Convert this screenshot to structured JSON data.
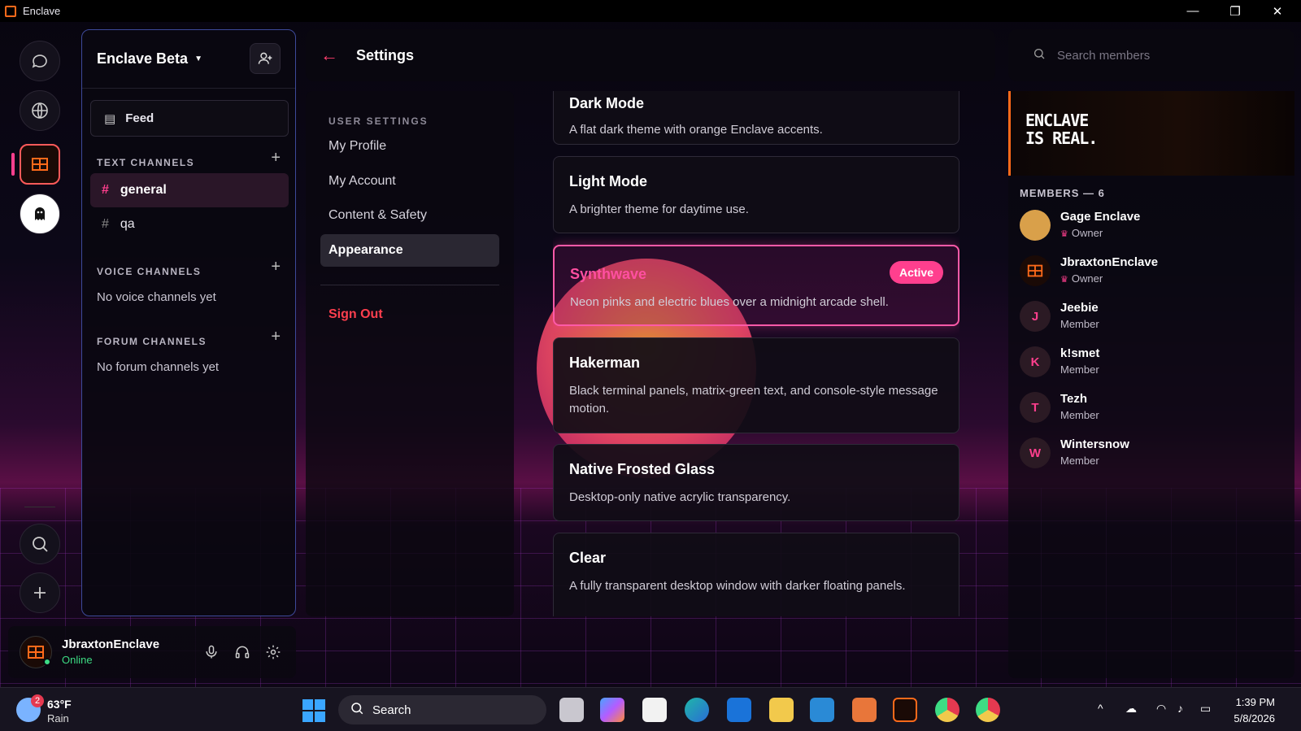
{
  "window": {
    "title": "Enclave",
    "minimize": "—",
    "restore": "❐",
    "close": "✕"
  },
  "rail": {
    "items": [
      {
        "name": "messages-icon"
      },
      {
        "name": "globe-icon"
      },
      {
        "name": "enclave-server-icon"
      },
      {
        "name": "ghost-server-icon"
      },
      {
        "name": "search-icon"
      },
      {
        "name": "add-server-icon"
      }
    ]
  },
  "server": {
    "name": "Enclave Beta",
    "feed_label": "Feed",
    "text_channels_title": "TEXT CHANNELS",
    "text_channels": [
      {
        "name": "general",
        "active": true
      },
      {
        "name": "qa",
        "active": false
      }
    ],
    "voice_channels_title": "VOICE CHANNELS",
    "voice_empty": "No voice channels yet",
    "forum_channels_title": "FORUM CHANNELS",
    "forum_empty": "No forum channels yet",
    "add_symbol": "+",
    "hash_symbol": "#"
  },
  "user": {
    "name": "JbraxtonEnclave",
    "status": "Online",
    "status_color": "#3ddc84"
  },
  "settings": {
    "back_symbol": "←",
    "title": "Settings",
    "section_title": "USER SETTINGS",
    "nav": [
      "My Profile",
      "My Account",
      "Content & Safety",
      "Appearance"
    ],
    "active_nav": "Appearance",
    "sign_out": "Sign Out"
  },
  "themes": [
    {
      "title": "Dark Mode",
      "desc": "A flat dark theme with orange Enclave accents."
    },
    {
      "title": "Light Mode",
      "desc": "A brighter theme for daytime use."
    },
    {
      "title": "Synthwave",
      "desc": "Neon pinks and electric blues over a midnight arcade shell.",
      "active": true,
      "badge": "Active"
    },
    {
      "title": "Hakerman",
      "desc": "Black terminal panels, matrix-green text, and console-style message motion."
    },
    {
      "title": "Native Frosted Glass",
      "desc": "Desktop-only native acrylic transparency."
    },
    {
      "title": "Clear",
      "desc": "A fully transparent desktop window with darker floating panels."
    }
  ],
  "members": {
    "search_placeholder": "Search members",
    "banner_line1": "ENCLAVE",
    "banner_line2": "IS REAL.",
    "title": "MEMBERS — 6",
    "list": [
      {
        "name": "Gage Enclave",
        "role": "Owner",
        "initial": "",
        "owner": true
      },
      {
        "name": "JbraxtonEnclave",
        "role": "Owner",
        "initial": "",
        "owner": true
      },
      {
        "name": "Jeebie",
        "role": "Member",
        "initial": "J",
        "owner": false
      },
      {
        "name": "k!smet",
        "role": "Member",
        "initial": "K",
        "owner": false
      },
      {
        "name": "Tezh",
        "role": "Member",
        "initial": "T",
        "owner": false
      },
      {
        "name": "Wintersnow",
        "role": "Member",
        "initial": "W",
        "owner": false
      }
    ]
  },
  "taskbar": {
    "weather_temp": "63°F",
    "weather_desc": "Rain",
    "weather_badge": "2",
    "search_label": "Search",
    "time": "1:39 PM",
    "date": "5/8/2026",
    "tray_chevron": "^"
  },
  "colors": {
    "accent_pink": "#ff3f8e",
    "accent_orange": "#ff6a1a",
    "border_blue": "#3d4a9a"
  }
}
